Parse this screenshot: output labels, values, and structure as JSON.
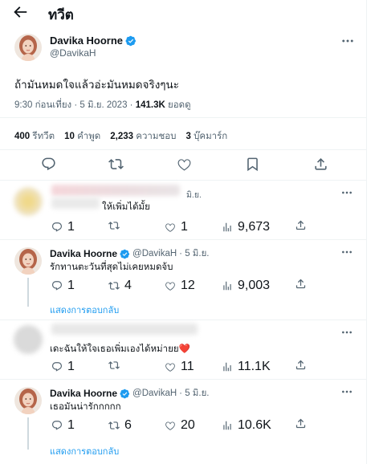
{
  "header": {
    "title": "ทวีต"
  },
  "main_tweet": {
    "name": "Davika Hoorne",
    "handle": "@DavikaH",
    "text": "ถ้ามันหมดใจแล้วอ่ะมันหมดจริงๆนะ",
    "time": "9:30 ก่อนเที่ยง · 5 มิ.ย. 2023 ·",
    "views": "141.3K",
    "views_label": "ยอดดู",
    "stats": {
      "retweets": "400",
      "retweets_label": "รีทวีต",
      "quotes": "10",
      "quotes_label": "คำพูด",
      "likes": "2,233",
      "likes_label": "ความชอบ",
      "bookmarks": "3",
      "bookmarks_label": "บุ๊คมาร์ก"
    }
  },
  "replies": [
    {
      "date": "มิ.ย.",
      "text": "ให้เพิ่มได้มั้ย",
      "reply_count": "1",
      "retweet_count": "",
      "like_count": "1",
      "view_count": "9,673"
    },
    {
      "name": "Davika Hoorne",
      "handle": "@DavikaH",
      "date": "· 5 มิ.ย.",
      "text": "รักทานตะวันที่สุดไม่เคยหมดจ้บ",
      "reply_count": "1",
      "retweet_count": "4",
      "like_count": "12",
      "view_count": "9,003",
      "show_replies": "แสดงการตอบกลับ"
    },
    {
      "text": "เดะฉันให้ใจเธอเพิ่มเองได้หม่ายย",
      "emoji": "❤️",
      "reply_count": "1",
      "retweet_count": "",
      "like_count": "11",
      "view_count": "11.1K"
    },
    {
      "name": "Davika Hoorne",
      "handle": "@DavikaH",
      "date": "· 5 มิ.ย.",
      "text": "เธอมันน่ารักกกกก",
      "reply_count": "1",
      "retweet_count": "6",
      "like_count": "20",
      "view_count": "10.6K",
      "show_replies": "แสดงการตอบกลับ"
    }
  ],
  "colors": {
    "accent": "#1d9bf0",
    "muted": "#536471",
    "text": "#0f1419",
    "divider": "#eff3f4"
  }
}
